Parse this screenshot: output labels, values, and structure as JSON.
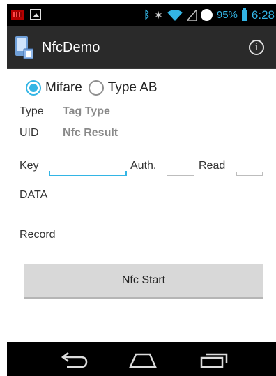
{
  "status_bar": {
    "battery_percent": "95%",
    "time": "6:28",
    "icons": [
      "notification-grid-icon",
      "gallery-icon",
      "bluetooth-icon",
      "vibrate-icon",
      "wifi-icon",
      "signal-icon",
      "sync-circle-icon",
      "battery-icon"
    ]
  },
  "action_bar": {
    "title": "NfcDemo",
    "info_glyph": "i"
  },
  "mode": {
    "options": [
      {
        "label": "Mifare",
        "checked": true
      },
      {
        "label": "Type AB",
        "checked": false
      }
    ]
  },
  "fields": {
    "type_label": "Type",
    "type_value": "Tag Type",
    "uid_label": "UID",
    "uid_value": "Nfc Result",
    "key_label": "Key",
    "key_value": "",
    "auth_label": "Auth.",
    "auth_value": "",
    "read_label": "Read",
    "read_value": "",
    "data_label": "DATA",
    "record_label": "Record"
  },
  "start_button": {
    "label": "Nfc Start"
  },
  "nav_bar": {
    "buttons": [
      "back-icon",
      "home-icon",
      "recents-icon"
    ]
  },
  "colors": {
    "accent": "#33b5e5",
    "action_bar_bg": "#2a2a2a",
    "status_bar_bg": "#000000",
    "button_bg": "#d8d8d8"
  }
}
